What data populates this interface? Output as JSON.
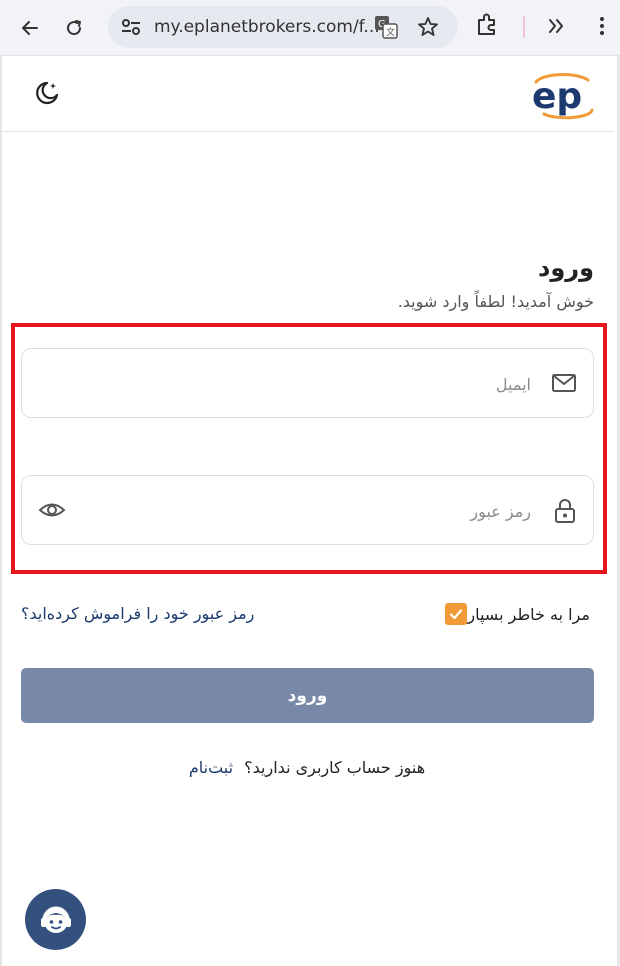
{
  "browser": {
    "url": "my.eplanetbrokers.com/f...",
    "icons": [
      "back-icon",
      "reload-icon",
      "site-settings-icon",
      "translate-icon",
      "bookmark-star-icon",
      "extensions-icon",
      "more-extensions-icon",
      "menu-kebab-icon"
    ]
  },
  "header": {
    "theme_toggle_icon": "moon-icon",
    "logo_text": "ep"
  },
  "login": {
    "title": "ورود",
    "subtitle": "خوش آمدید! لطفاً وارد شوید.",
    "email_placeholder": "ایمیل",
    "password_placeholder": "رمز عبور",
    "remember_label": "مرا به خاطر بسپار",
    "remember_checked": true,
    "forgot_link": "رمز عبور خود را فراموش کرده‌اید؟",
    "submit_label": "ورود",
    "signup_prompt": "هنوز حساب کاربری ندارید؟",
    "signup_link": "ثبت‌نام"
  },
  "colors": {
    "highlight": "#e8141c",
    "checkbox": "#f29a38",
    "submit_bg": "#7889a8",
    "link": "#1d3a70",
    "support_bg": "#34507f",
    "logo_blue": "#1d3a70",
    "logo_orange": "#f29a38"
  }
}
